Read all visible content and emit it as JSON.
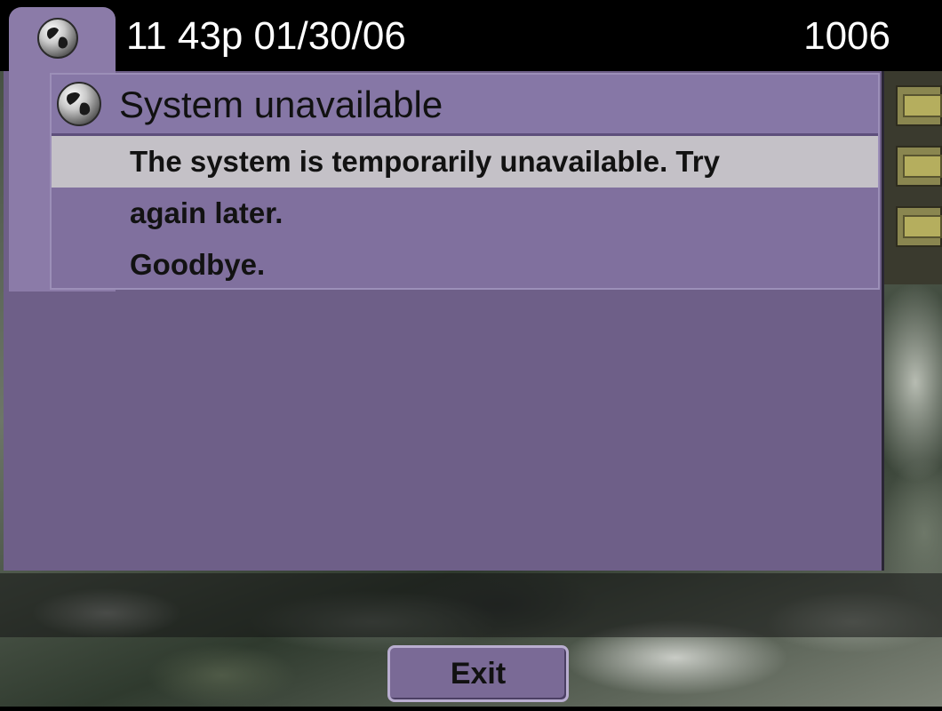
{
  "header": {
    "time_date": "11 43p 01/30/06",
    "extension": "1006",
    "line_icon": "globe-icon"
  },
  "dialog": {
    "icon": "globe-icon",
    "title": "System unavailable",
    "lines": [
      "The system is temporarily unavailable. Try",
      "again later.",
      "Goodbye."
    ]
  },
  "line_buttons": {
    "icon": "envelope-icon",
    "count": 3
  },
  "softkeys": [
    {
      "label": "Exit"
    }
  ],
  "colors": {
    "panel": "#6e5f88",
    "dialog": "#80709e",
    "selected_line": "#c4c1c7",
    "header_bg": "#000000",
    "header_text": "#ffffff"
  }
}
